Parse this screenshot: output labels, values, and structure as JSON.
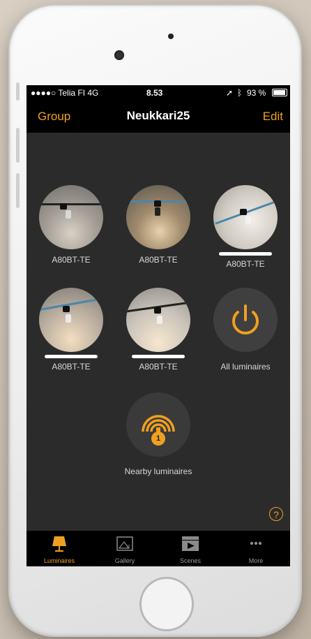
{
  "status": {
    "carrier": "●●●●○ Telia FI  4G",
    "time": "8.53",
    "battery": "93 %"
  },
  "nav": {
    "left": "Group",
    "title": "Neukkari25",
    "right": "Edit"
  },
  "luminaires": [
    {
      "label": "A80BT-TE",
      "selected": false
    },
    {
      "label": "A80BT-TE",
      "selected": false
    },
    {
      "label": "A80BT-TE",
      "selected": true
    },
    {
      "label": "A80BT-TE",
      "selected": true
    },
    {
      "label": "A80BT-TE",
      "selected": true
    }
  ],
  "all_luminaires": {
    "label": "All luminaires",
    "icon": "power-icon"
  },
  "nearby": {
    "label": "Nearby luminaires",
    "badge": "1",
    "icon": "proximity-icon"
  },
  "help": {
    "icon": "help-icon",
    "glyph": "?"
  },
  "tabs": [
    {
      "label": "Luminaires",
      "icon": "lamp-icon",
      "active": true
    },
    {
      "label": "Gallery",
      "icon": "gallery-icon",
      "active": false
    },
    {
      "label": "Scenes",
      "icon": "scenes-icon",
      "active": false
    },
    {
      "label": "More",
      "icon": "more-icon",
      "active": false
    }
  ],
  "colors": {
    "accent": "#f0a020",
    "background": "#2b2b2b",
    "bar": "#000000"
  }
}
